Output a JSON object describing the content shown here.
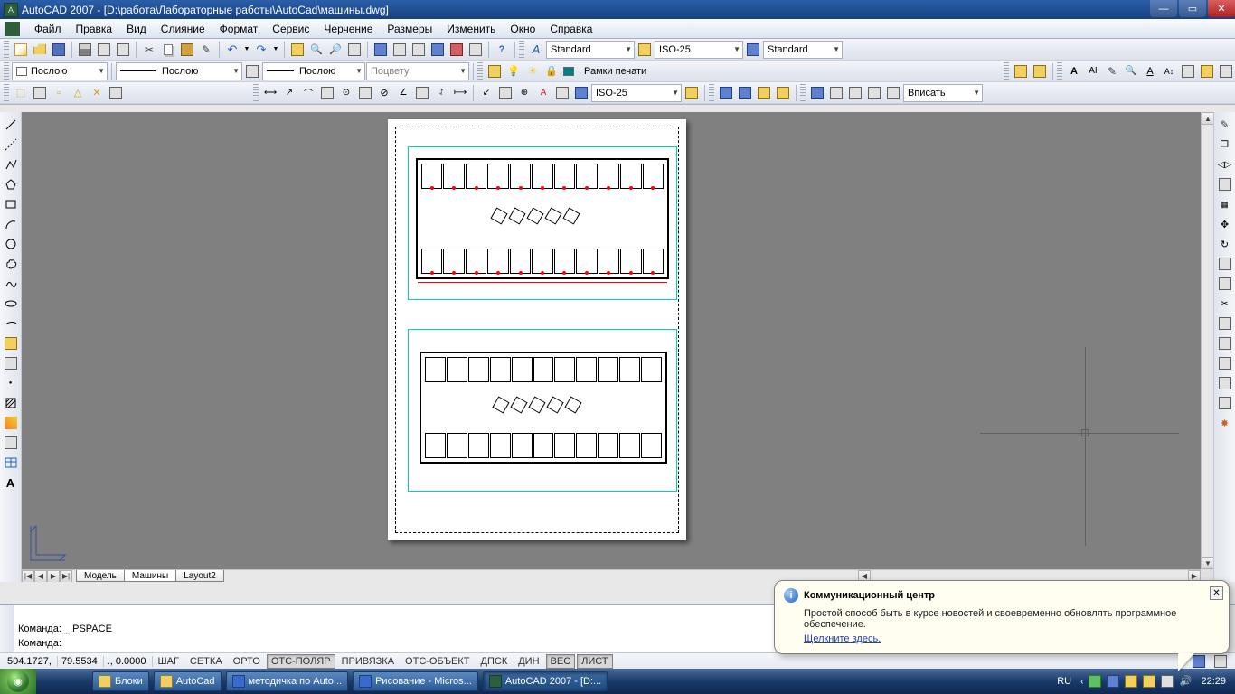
{
  "title": "AutoCAD 2007 - [D:\\работа\\Лабораторные работы\\AutoCad\\машины.dwg]",
  "menu": [
    "Файл",
    "Правка",
    "Вид",
    "Слияние",
    "Формат",
    "Сервис",
    "Черчение",
    "Размеры",
    "Изменить",
    "Окно",
    "Справка"
  ],
  "toolbar": {
    "layer_combo": "Послою",
    "linetype_combo": "Послою",
    "lineweight_combo": "Послою",
    "color_combo": "Поцвету",
    "text_style": "Standard",
    "dim_style1": "ISO-25",
    "table_style": "Standard",
    "dimstyle2": "ISO-25",
    "viewscale": "Вписать",
    "print_frames_label": "Рамки печати"
  },
  "tabs": {
    "nav": [
      "|◀",
      "◀",
      "▶",
      "▶|"
    ],
    "items": [
      "Модель",
      "Машины",
      "Layout2"
    ]
  },
  "cmd": {
    "l1": "Команда: _.PSPACE",
    "l2": "Команда:"
  },
  "status": {
    "coords": [
      "504.1727,",
      "79.5534",
      "., 0.0000"
    ],
    "toggles": [
      {
        "label": "ШАГ",
        "on": false
      },
      {
        "label": "СЕТКА",
        "on": false
      },
      {
        "label": "ОРТО",
        "on": false
      },
      {
        "label": "ОТС-ПОЛЯР",
        "on": true
      },
      {
        "label": "ПРИВЯЗКА",
        "on": false
      },
      {
        "label": "ОТС-ОБЪЕКТ",
        "on": false
      },
      {
        "label": "ДПСК",
        "on": false
      },
      {
        "label": "ДИН",
        "on": false
      },
      {
        "label": "ВЕС",
        "on": true
      },
      {
        "label": "ЛИСТ",
        "on": true
      }
    ]
  },
  "balloon": {
    "title": "Коммуникационный центр",
    "body": "Простой способ быть в курсе новостей и своевременно обновлять программное обеспечение.",
    "link": "Щелкните здесь."
  },
  "taskbar": {
    "items": [
      {
        "label": "Блоки",
        "active": false,
        "color": "#f0d060"
      },
      {
        "label": "AutoCad",
        "active": false,
        "color": "#f0d060"
      },
      {
        "label": "методичка по Auto...",
        "active": false,
        "color": "#3a6ad0"
      },
      {
        "label": "Рисование - Micros...",
        "active": false,
        "color": "#3a6ad0"
      },
      {
        "label": "AutoCAD 2007 - [D:...",
        "active": true,
        "color": "#2e5e3e"
      }
    ],
    "lang": "RU",
    "clock": "22:29"
  }
}
